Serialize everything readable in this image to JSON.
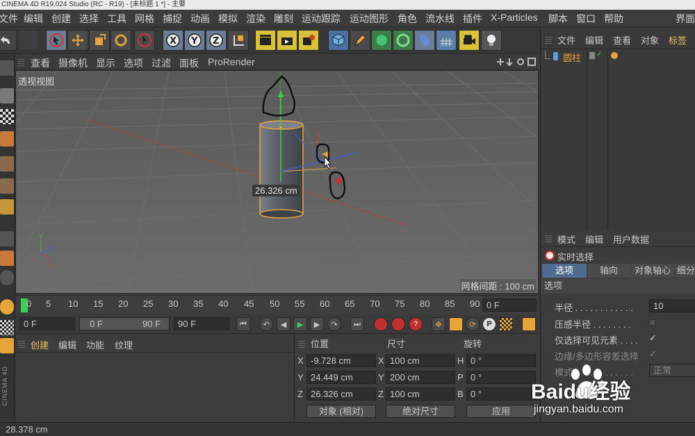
{
  "window": {
    "title": "CINEMA 4D R19.024 Studio (RC - R19) - [未标题 1 *] - 主要"
  },
  "menubar": {
    "items": [
      "文件",
      "编辑",
      "创建",
      "选择",
      "工具",
      "网格",
      "捕捉",
      "动画",
      "模拟",
      "渲染",
      "雕刻",
      "运动跟踪",
      "运动图形",
      "角色",
      "流水线",
      "插件",
      "X-Particles",
      "脚本",
      "窗口",
      "帮助",
      "界面"
    ]
  },
  "toolbar": {
    "icons": [
      "undo-icon",
      "redo-icon",
      "live-select-icon",
      "move-icon",
      "scale-icon",
      "rotate-icon",
      "select-icon",
      "x-axis-icon",
      "y-axis-icon",
      "z-axis-icon",
      "coordinate-system-icon",
      "render-view-icon",
      "render-picture-viewer-icon",
      "render-settings-icon",
      "cube-icon",
      "pen-icon",
      "subdivision-icon",
      "cloner-icon",
      "deformer-icon",
      "floor-icon",
      "camera-icon",
      "light-icon"
    ]
  },
  "viewport": {
    "menu": [
      "查看",
      "摄像机",
      "显示",
      "选项",
      "过滤",
      "面板",
      "ProRender"
    ],
    "label": "透视视图",
    "measure": "26.326 cm",
    "grid_spacing": "网格间距 : 100 cm"
  },
  "timeline": {
    "ticks": [
      "0",
      "5",
      "10",
      "15",
      "20",
      "25",
      "30",
      "35",
      "40",
      "45",
      "50",
      "55",
      "60",
      "65",
      "70",
      "75",
      "80",
      "85",
      "90"
    ],
    "current_frame": "0 F"
  },
  "playbar": {
    "start": "0 F",
    "range_start": "0 F",
    "range_end": "90 F",
    "end": "90 F"
  },
  "material_panel": {
    "menu": [
      "创建",
      "编辑",
      "功能",
      "纹理"
    ]
  },
  "coords": {
    "headers": {
      "position": "位置",
      "size": "尺寸",
      "rotation": "旋转"
    },
    "rows": [
      {
        "axis": "X",
        "pos": "-9.728 cm",
        "saxis": "X",
        "size": "100 cm",
        "raxis": "H",
        "rot": "0 °"
      },
      {
        "axis": "Y",
        "pos": "24.449 cm",
        "saxis": "Y",
        "size": "200 cm",
        "raxis": "P",
        "rot": "0 °"
      },
      {
        "axis": "Z",
        "pos": "26.326 cm",
        "saxis": "Z",
        "size": "100 cm",
        "raxis": "B",
        "rot": "0 °"
      }
    ],
    "mode_select": "对象 (相对)",
    "size_select": "绝对尺寸",
    "apply": "应用"
  },
  "object_manager": {
    "menu": [
      "文件",
      "编辑",
      "查看",
      "对象",
      "标签"
    ],
    "objects": [
      {
        "name": "圆柱",
        "icon": "cylinder-icon"
      }
    ]
  },
  "attributes": {
    "menu": [
      "模式",
      "编辑",
      "用户数据"
    ],
    "tool_name": "实时选择",
    "tabs": [
      "选项",
      "轴向",
      "对象轴心",
      "细分"
    ],
    "section": "选项",
    "fields": [
      {
        "label": "半径 . . . . . . . . . . . .",
        "value": "10"
      },
      {
        "label": "压感半径 . . . . . . . .",
        "value": ""
      },
      {
        "label": "仅选择可见元素 . . . .",
        "value": "✓"
      },
      {
        "label": "边缘/多边形容差选择",
        "value": "✓"
      },
      {
        "label": "模式 . . . . . . . . . . . .",
        "value": "正常"
      }
    ]
  },
  "status": {
    "text": "28.378 cm"
  },
  "watermark": {
    "brand": "Baidu经验",
    "url": "jingyan.baidu.com"
  },
  "side_logo": "CINEMA 4D",
  "colors": {
    "accent": "#e8a33a",
    "highlight_blue": "#4f6b8f",
    "viewport_bg": "#626262"
  }
}
